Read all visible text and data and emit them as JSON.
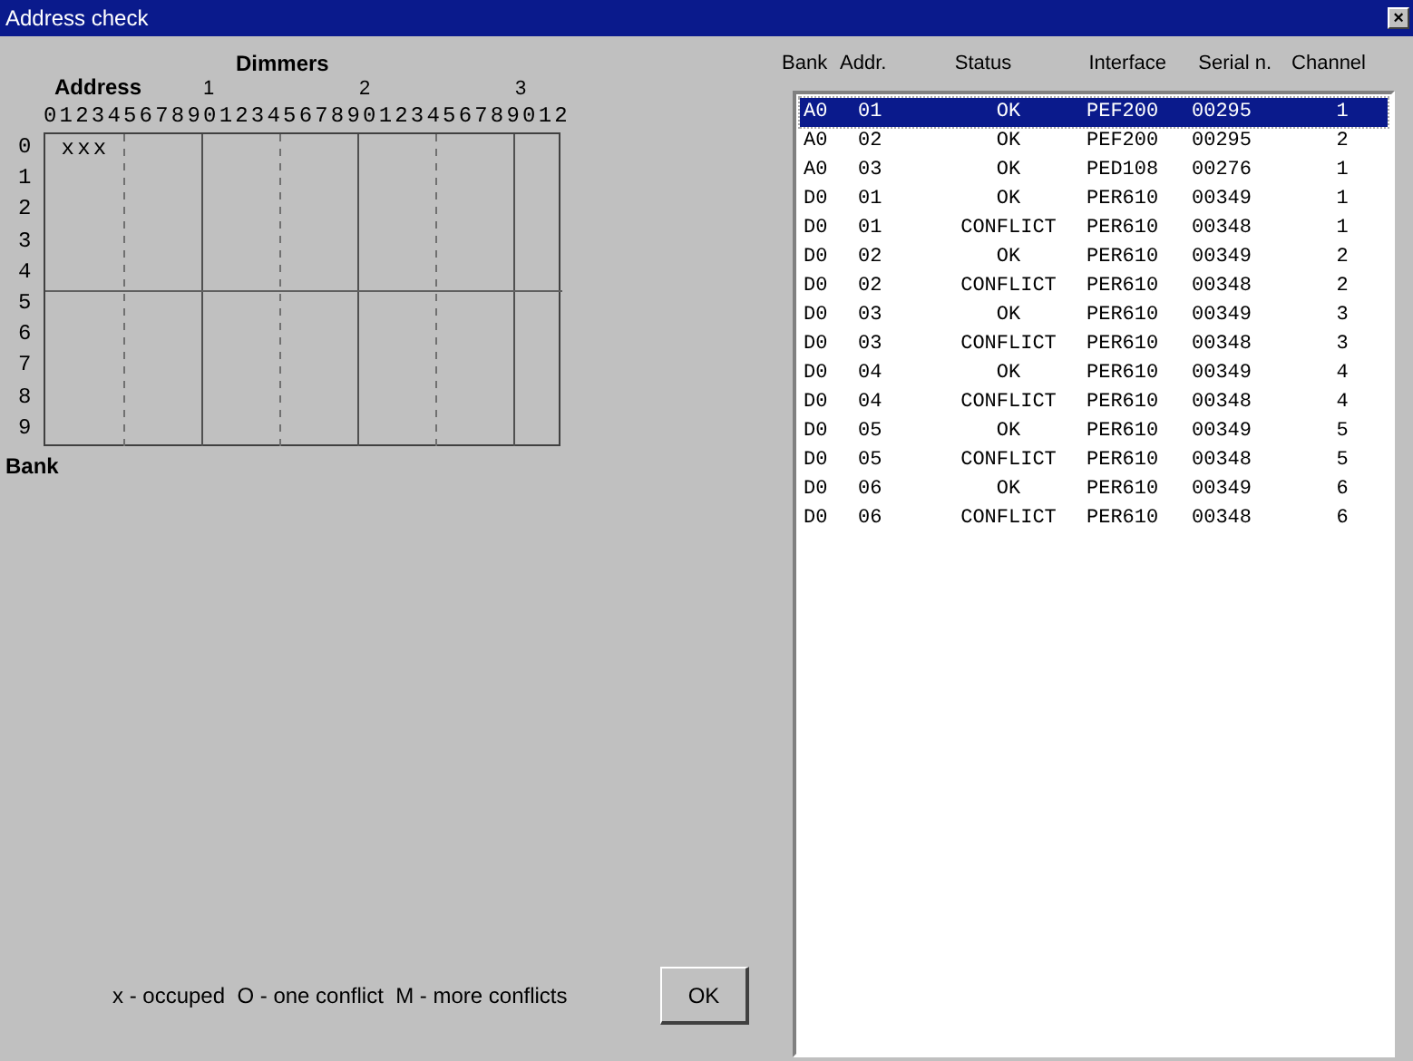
{
  "window": {
    "title": "Address check",
    "close": "×"
  },
  "grid": {
    "title": "Dimmers",
    "address_label": "Address",
    "tens": [
      "1",
      "2",
      "3"
    ],
    "digits": "012345678901234567890123456789012",
    "bank_label": "Bank",
    "rows": [
      {
        "label": "0",
        "marks": " xxx"
      },
      {
        "label": "1"
      },
      {
        "label": "2"
      },
      {
        "label": "3"
      },
      {
        "label": "4"
      },
      {
        "label": "5"
      },
      {
        "label": "6"
      },
      {
        "label": "7"
      },
      {
        "label": "8"
      },
      {
        "label": "9"
      }
    ]
  },
  "legend": "x - occuped  O - one conflict  M - more conflicts",
  "ok_button": "OK",
  "list": {
    "columns": [
      "Bank",
      "Addr.",
      "Status",
      "Interface",
      "Serial n.",
      "Channel"
    ],
    "rows": [
      {
        "cells": [
          "A0",
          "01",
          "OK",
          "PEF200",
          "00295",
          "1"
        ],
        "selected": true
      },
      {
        "cells": [
          "A0",
          "02",
          "OK",
          "PEF200",
          "00295",
          "2"
        ],
        "selected": false
      },
      {
        "cells": [
          "A0",
          "03",
          "OK",
          "PED108",
          "00276",
          "1"
        ],
        "selected": false
      },
      {
        "cells": [
          "D0",
          "01",
          "OK",
          "PER610",
          "00349",
          "1"
        ],
        "selected": false
      },
      {
        "cells": [
          "D0",
          "01",
          "CONFLICT",
          "PER610",
          "00348",
          "1"
        ],
        "selected": false
      },
      {
        "cells": [
          "D0",
          "02",
          "OK",
          "PER610",
          "00349",
          "2"
        ],
        "selected": false
      },
      {
        "cells": [
          "D0",
          "02",
          "CONFLICT",
          "PER610",
          "00348",
          "2"
        ],
        "selected": false
      },
      {
        "cells": [
          "D0",
          "03",
          "OK",
          "PER610",
          "00349",
          "3"
        ],
        "selected": false
      },
      {
        "cells": [
          "D0",
          "03",
          "CONFLICT",
          "PER610",
          "00348",
          "3"
        ],
        "selected": false
      },
      {
        "cells": [
          "D0",
          "04",
          "OK",
          "PER610",
          "00349",
          "4"
        ],
        "selected": false
      },
      {
        "cells": [
          "D0",
          "04",
          "CONFLICT",
          "PER610",
          "00348",
          "4"
        ],
        "selected": false
      },
      {
        "cells": [
          "D0",
          "05",
          "OK",
          "PER610",
          "00349",
          "5"
        ],
        "selected": false
      },
      {
        "cells": [
          "D0",
          "05",
          "CONFLICT",
          "PER610",
          "00348",
          "5"
        ],
        "selected": false
      },
      {
        "cells": [
          "D0",
          "06",
          "OK",
          "PER610",
          "00349",
          "6"
        ],
        "selected": false
      },
      {
        "cells": [
          "D0",
          "06",
          "CONFLICT",
          "PER610",
          "00348",
          "6"
        ],
        "selected": false
      }
    ]
  }
}
